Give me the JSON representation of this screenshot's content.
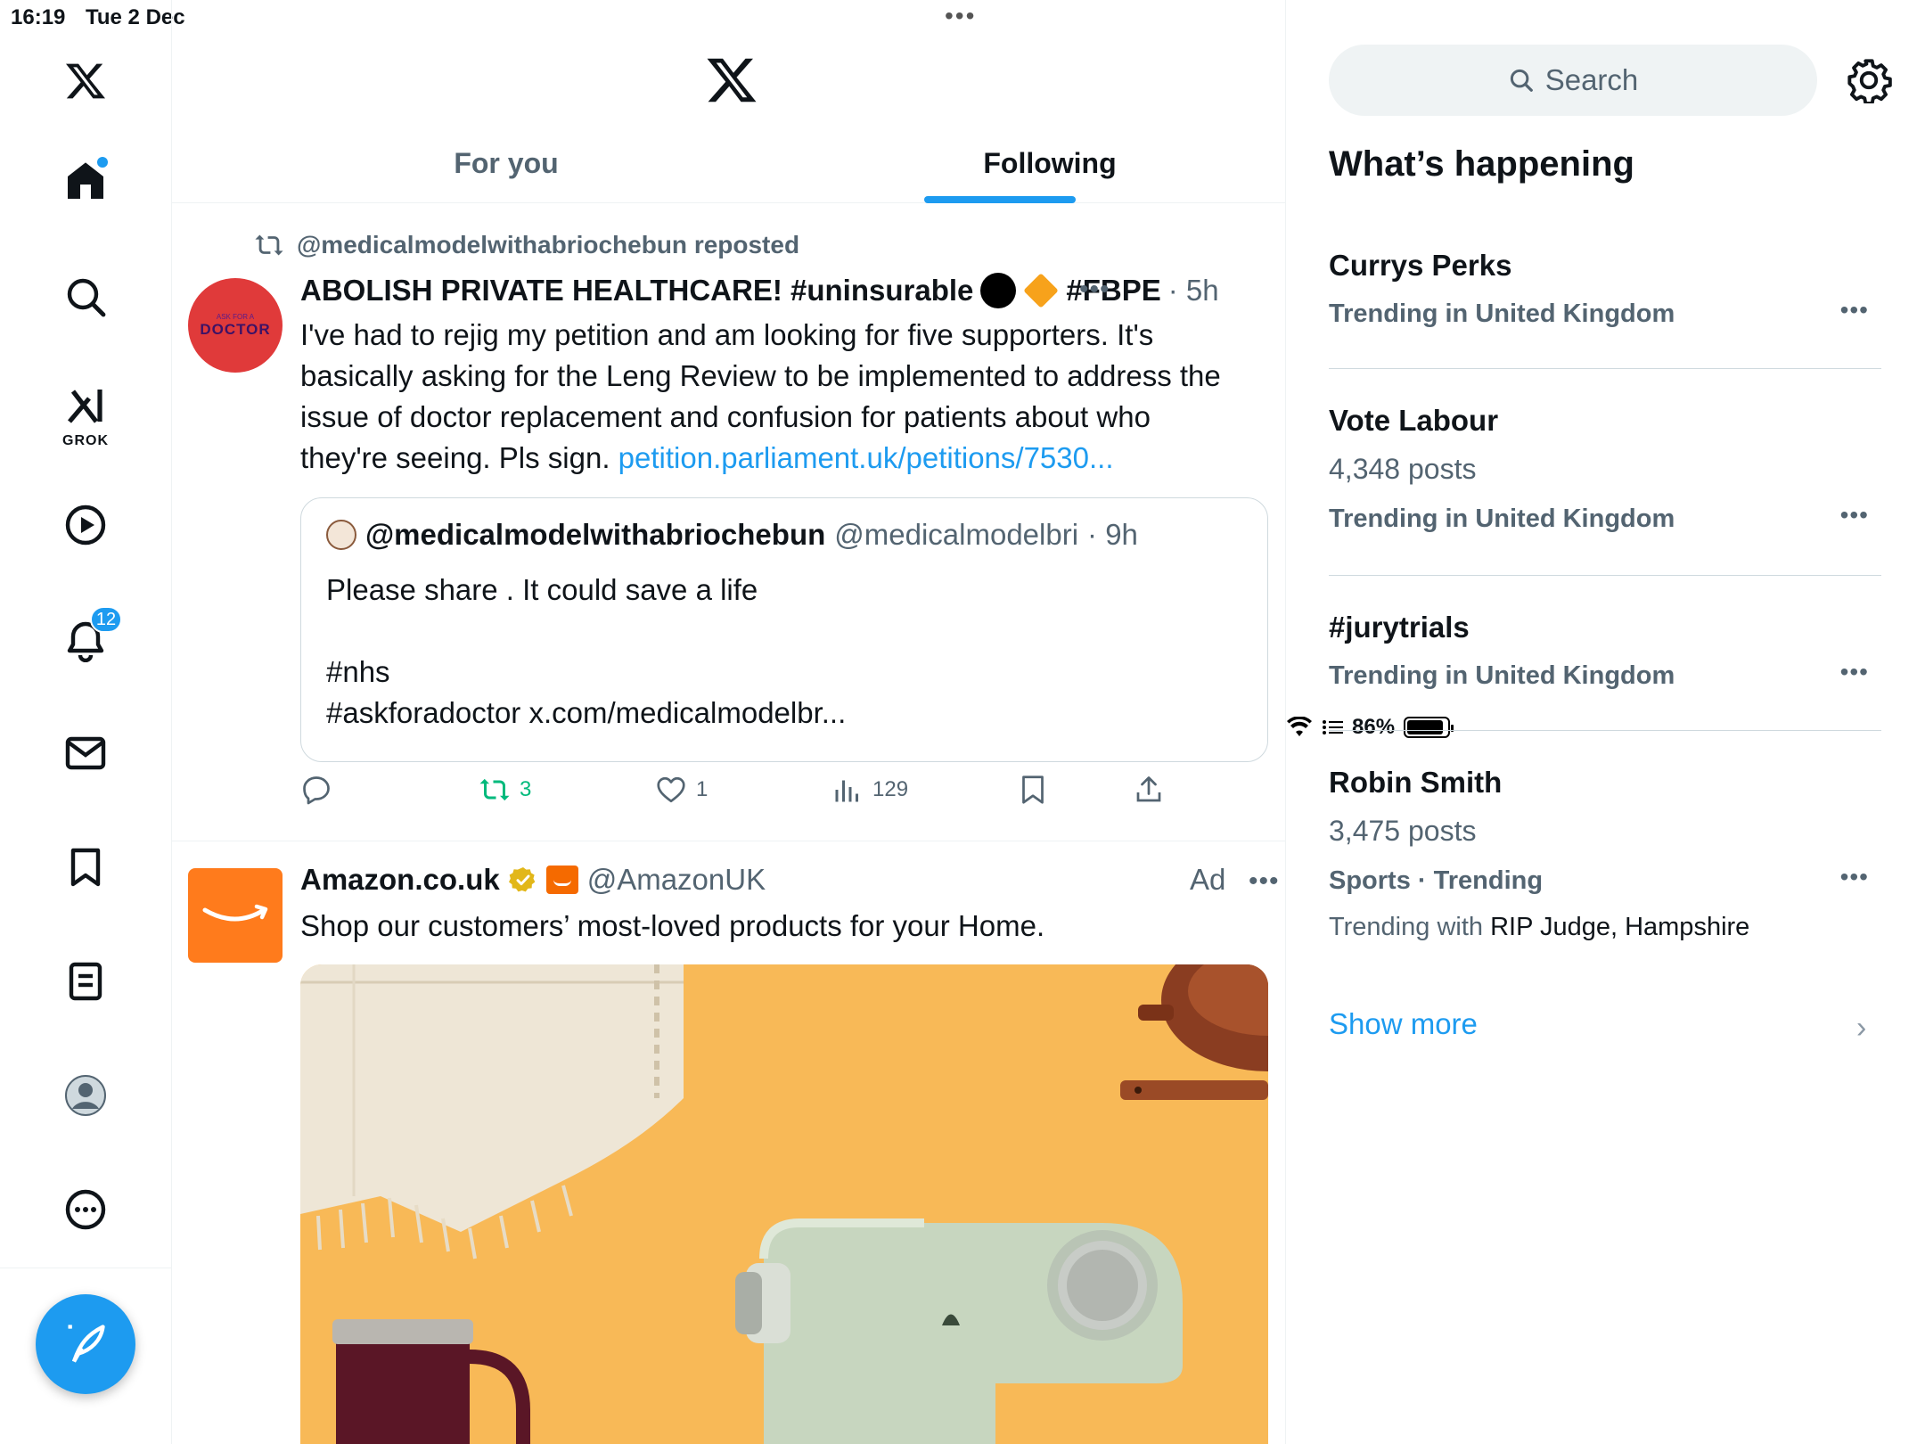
{
  "status_bar": {
    "time": "16:19",
    "date": "Tue 2 Dec",
    "battery": "86%"
  },
  "nav": {
    "notifications_count": "12",
    "grok_label": "GROK"
  },
  "tabs": {
    "for_you": "For you",
    "following": "Following"
  },
  "post1": {
    "repost_text": "@medicalmodelwithabriochebun reposted",
    "avatar_small": "ASK FOR A",
    "avatar_big": "DOCTOR",
    "name": "ABOLISH PRIVATE HEALTHCARE! #uninsurable",
    "tag": "#FBPE",
    "time": "· 5h",
    "body": "I've had to rejig my petition and am looking for five supporters. It's basically asking for the Leng Review to be implemented to address the issue of doctor replacement and confusion for patients about who they're seeing. Pls sign. ",
    "link": "petition.parliament.uk/petitions/7530...",
    "quote": {
      "name": "@medicalmodelwithabriochebun",
      "handle": "@medicalmodelbri",
      "time": "· 9h",
      "line1": "Please share . It could save a life",
      "line2": "#nhs",
      "line3": "#askforadoctor x.com/medicalmodelbr..."
    },
    "actions": {
      "reposts": "3",
      "likes": "1",
      "views": "129"
    }
  },
  "post2": {
    "name": "Amazon.co.uk",
    "handle": "@AmazonUK",
    "ad_label": "Ad",
    "body": "Shop our customers’ most-loved products for your Home."
  },
  "sidebar": {
    "search_placeholder": "Search",
    "title": "What’s happening",
    "trends": [
      {
        "name": "Currys Perks",
        "posts": "",
        "context": "Trending in United Kingdom"
      },
      {
        "name": "Vote Labour",
        "posts": "4,348 posts",
        "context": "Trending in United Kingdom"
      },
      {
        "name": "#jurytrials",
        "posts": "",
        "context": "Trending in United Kingdom"
      },
      {
        "name": "Robin Smith",
        "posts": "3,475 posts",
        "context": "Sports · Trending",
        "with_label": "Trending with",
        "with_value": "RIP Judge, Hampshire"
      }
    ],
    "show_more": "Show more"
  },
  "colors": {
    "accent": "#1d9bf0",
    "retweet": "#00ba7c",
    "amazon": "#ff7b1c",
    "ad_background": "#f8b957"
  },
  "icons": [
    "x-logo-icon",
    "home-icon",
    "search-icon",
    "grok-icon",
    "video-icon",
    "bell-icon",
    "mail-icon",
    "bookmark-icon",
    "list-icon",
    "profile-icon",
    "more-icon",
    "compose-icon",
    "gear-icon"
  ]
}
